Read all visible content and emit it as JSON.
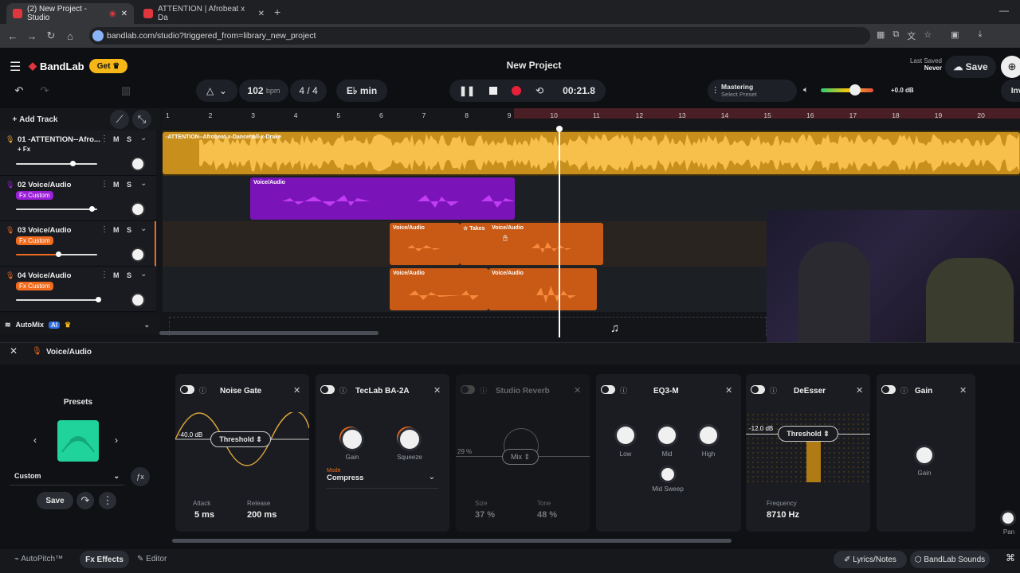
{
  "browser": {
    "tabs": [
      {
        "title": "(2) New Project - Studio",
        "active": true
      },
      {
        "title": "ATTENTION | Afrobeat x Da",
        "active": false
      }
    ],
    "url": "bandlab.com/studio?triggered_from=library_new_project"
  },
  "header": {
    "brand": "BandLab",
    "get_label": "Get",
    "project_title": "New Project",
    "last_saved_label": "Last Saved",
    "last_saved_value": "Never",
    "save_label": "Save"
  },
  "transport": {
    "bpm_value": "102",
    "bpm_unit": "bpm",
    "time_signature": "4 / 4",
    "key": "E♭ min",
    "time": "00:21.8",
    "mastering_title": "Mastering",
    "mastering_sub": "Select Preset",
    "volume_db": "+0.0 dB",
    "invite_label": "Inv"
  },
  "tracks_panel": {
    "add_track": "Add Track",
    "tracks": [
      {
        "name": "01 -ATTENTION--Afro...",
        "badge": "+ Fx",
        "color": "#f0a830",
        "volume": 0.44
      },
      {
        "name": "02 Voice/Audio",
        "badge": "Fx Custom",
        "color": "#9a1fd9",
        "volume": 0.57
      },
      {
        "name": "03 Voice/Audio",
        "badge": "Fx Custom",
        "color": "#f06b1e",
        "volume": 0.35
      },
      {
        "name": "04 Voice/Audio",
        "badge": "Fx Custom",
        "color": "#f06b1e",
        "volume": 0.61
      }
    ],
    "mute_label": "M",
    "solo_label": "S",
    "automix_label": "AutoMix",
    "ai_label": "AI"
  },
  "ruler": [
    "1",
    "2",
    "3",
    "4",
    "5",
    "6",
    "7",
    "8",
    "9",
    "10",
    "11",
    "12",
    "13",
    "14",
    "15",
    "16",
    "17",
    "18",
    "19",
    "20"
  ],
  "clips": {
    "track1": "-ATTENTION--Afrobeat-x-Dancehall-x-Drake",
    "voice": "Voice/Audio",
    "takes": "Takes"
  },
  "fx_panel": {
    "track_title": "Voice/Audio",
    "presets_label": "Presets",
    "preset_value": "Custom",
    "save_label": "Save",
    "noise_gate": {
      "title": "Noise Gate",
      "threshold": "Threshold",
      "db": "-40.0 dB",
      "attack_label": "Attack",
      "attack_value": "5 ms",
      "release_label": "Release",
      "release_value": "200 ms"
    },
    "teclab": {
      "title": "TecLab BA-2A",
      "gain": "Gain",
      "squeeze": "Squeeze",
      "mode_label": "Mode",
      "mode_value": "Compress"
    },
    "reverb": {
      "title": "Studio Reverb",
      "mix": "Mix",
      "pct": "29 %",
      "size_label": "Size",
      "size_value": "37 %",
      "tone_label": "Tone",
      "tone_value": "48 %"
    },
    "eq": {
      "title": "EQ3-M",
      "low": "Low",
      "mid": "Mid",
      "high": "High",
      "sweep": "Mid Sweep"
    },
    "deesser": {
      "title": "DeEsser",
      "threshold": "Threshold",
      "db": "-12.0 dB",
      "freq_label": "Frequency",
      "freq_value": "8710 Hz"
    },
    "gain": {
      "title": "Gain",
      "knob": "Gain"
    },
    "pan_label": "Pan"
  },
  "bottom": {
    "autopitch": "AutoPitch™",
    "effects": "Effects",
    "editor": "Editor",
    "lyrics": "Lyrics/Notes",
    "sounds": "BandLab Sounds"
  },
  "colors": {
    "accent": "#f0a830",
    "purple": "#9a1fd9",
    "orange": "#f06b1e",
    "record": "#e8213a"
  }
}
